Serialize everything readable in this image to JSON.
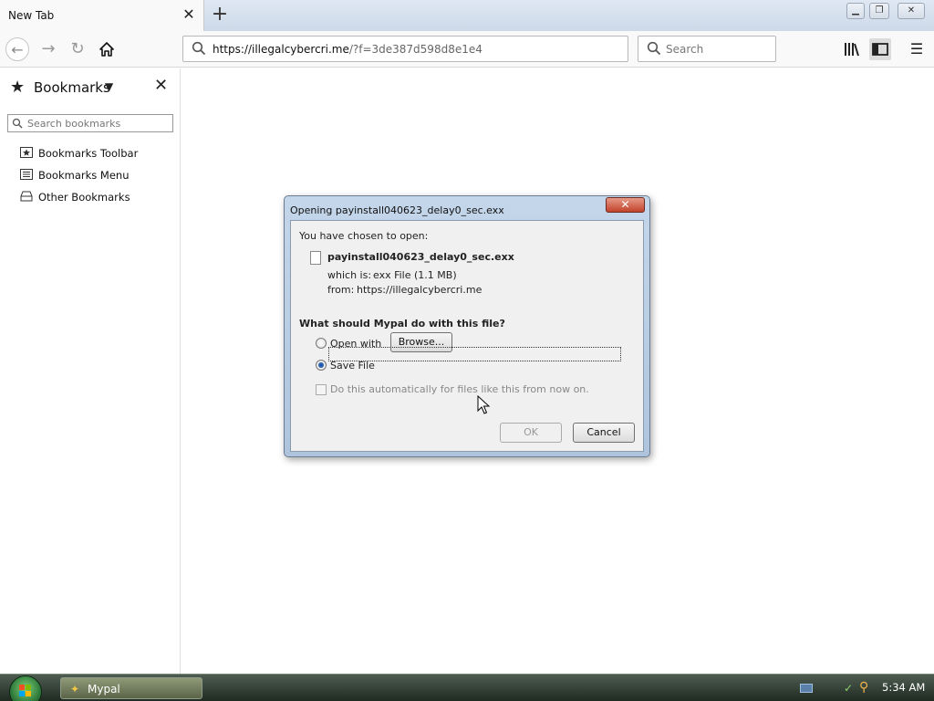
{
  "browser": {
    "tab": {
      "title": "New Tab",
      "close_icon": "close-icon"
    },
    "window_controls": {
      "minimize": "minimize-icon",
      "maximize": "maximize-icon",
      "close": "close-icon"
    },
    "urlbar": {
      "url_host": "https://illegalcybercri.me",
      "url_rest": "/?f=3de387d598d8e1e4"
    },
    "search": {
      "placeholder": "Search"
    }
  },
  "sidebar": {
    "title": "Bookmarks",
    "search_placeholder": "Search bookmarks",
    "items": [
      {
        "label": "Bookmarks Toolbar",
        "icon": "bookmarks-toolbar-icon"
      },
      {
        "label": "Bookmarks Menu",
        "icon": "bookmarks-menu-icon"
      },
      {
        "label": "Other Bookmarks",
        "icon": "other-bookmarks-icon"
      }
    ]
  },
  "dialog": {
    "title": "Opening payinstall040623_delay0_sec.exx",
    "intro": "You have chosen to open:",
    "filename": "payinstall040623_delay0_sec.exx",
    "which_is_label": "which is:",
    "which_is_value": "exx File (1.1 MB)",
    "from_label": "from:",
    "from_value": "https://illegalcybercri.me",
    "question": "What should Mypal do with this file?",
    "open_with_label": "Open with",
    "browse_label": "Browse...",
    "save_file_label": "Save File",
    "auto_label": "Do this automatically for files like this from now on.",
    "ok_label": "OK",
    "cancel_label": "Cancel",
    "selected_option": "Save File"
  },
  "taskbar": {
    "app_label": "Mypal",
    "clock": "5:34 AM"
  }
}
